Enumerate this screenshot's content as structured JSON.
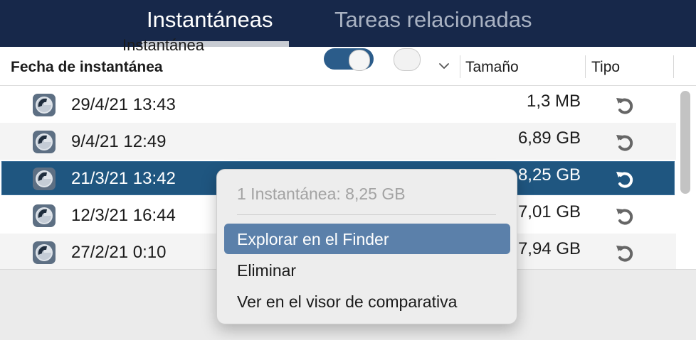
{
  "tabs": [
    {
      "label": "Instantáneas",
      "active": true
    },
    {
      "label": "Tareas relacionadas",
      "active": false
    }
  ],
  "table": {
    "columns": [
      "Fecha de instantánea",
      "Tamaño",
      "Tipo"
    ],
    "rows": [
      {
        "date": "29/4/21 13:43",
        "size": "1,3 MB",
        "selected": false
      },
      {
        "date": "9/4/21 12:49",
        "size": "6,89 GB",
        "selected": false
      },
      {
        "date": "21/3/21 13:42",
        "size": "8,25 GB",
        "selected": true
      },
      {
        "date": "12/3/21 16:44",
        "size": "7,01 GB",
        "selected": false
      },
      {
        "date": "27/2/21 0:10",
        "size": "7,94 GB",
        "selected": false
      }
    ]
  },
  "bottom": {
    "label": "Instantánea"
  },
  "context_menu": {
    "header": "1 Instantánea: 8,25 GB",
    "items": [
      {
        "label": "Explorar en el Finder",
        "highlighted": true
      },
      {
        "label": "Eliminar",
        "highlighted": false
      },
      {
        "label": "Ver en el visor de comparativa",
        "highlighted": false
      }
    ]
  },
  "colors": {
    "topbar": "#17284a",
    "selection": "#1f5680",
    "menu_highlight": "#5b80aa"
  },
  "icons": {
    "row_icon": "time-machine-snapshot-icon",
    "type_icon": "restore-icon",
    "sort_icon": "chevron-down-icon"
  }
}
